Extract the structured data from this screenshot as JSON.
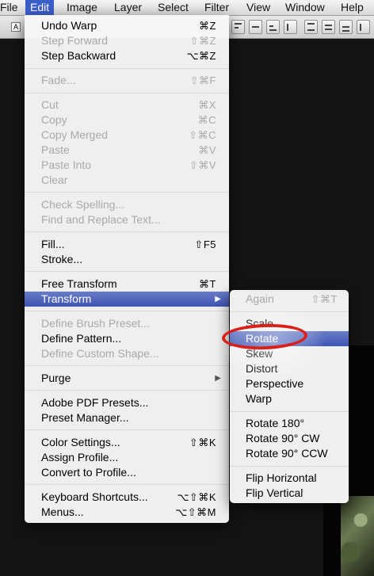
{
  "menubar": {
    "items": [
      "File",
      "Edit",
      "Image",
      "Layer",
      "Select",
      "Filter",
      "View",
      "Window",
      "Help"
    ],
    "active": "Edit"
  },
  "options_bar": {
    "checkbox_label": "A"
  },
  "edit_menu": {
    "undo_warp": {
      "label": "Undo Warp",
      "shortcut": "⌘Z"
    },
    "step_forward": {
      "label": "Step Forward",
      "shortcut": "⇧⌘Z"
    },
    "step_backward": {
      "label": "Step Backward",
      "shortcut": "⌥⌘Z"
    },
    "fade": {
      "label": "Fade...",
      "shortcut": "⇧⌘F"
    },
    "cut": {
      "label": "Cut",
      "shortcut": "⌘X"
    },
    "copy": {
      "label": "Copy",
      "shortcut": "⌘C"
    },
    "copy_merged": {
      "label": "Copy Merged",
      "shortcut": "⇧⌘C"
    },
    "paste": {
      "label": "Paste",
      "shortcut": "⌘V"
    },
    "paste_into": {
      "label": "Paste Into",
      "shortcut": "⇧⌘V"
    },
    "clear": {
      "label": "Clear"
    },
    "check_spelling": {
      "label": "Check Spelling..."
    },
    "find_replace": {
      "label": "Find and Replace Text..."
    },
    "fill": {
      "label": "Fill...",
      "shortcut": "⇧F5"
    },
    "stroke": {
      "label": "Stroke..."
    },
    "free_transform": {
      "label": "Free Transform",
      "shortcut": "⌘T"
    },
    "transform": {
      "label": "Transform",
      "arrow": "▶"
    },
    "define_brush": {
      "label": "Define Brush Preset..."
    },
    "define_pattern": {
      "label": "Define Pattern..."
    },
    "define_custom_shape": {
      "label": "Define Custom Shape..."
    },
    "purge": {
      "label": "Purge",
      "arrow": "▶"
    },
    "pdf_presets": {
      "label": "Adobe PDF Presets..."
    },
    "preset_manager": {
      "label": "Preset Manager..."
    },
    "color_settings": {
      "label": "Color Settings...",
      "shortcut": "⇧⌘K"
    },
    "assign_profile": {
      "label": "Assign Profile..."
    },
    "convert_profile": {
      "label": "Convert to Profile..."
    },
    "keyboard_shortcuts": {
      "label": "Keyboard Shortcuts...",
      "shortcut": "⌥⇧⌘K"
    },
    "menus": {
      "label": "Menus...",
      "shortcut": "⌥⇧⌘M"
    }
  },
  "transform_submenu": {
    "again": {
      "label": "Again",
      "shortcut": "⇧⌘T"
    },
    "scale": {
      "label": "Scale"
    },
    "rotate": {
      "label": "Rotate"
    },
    "skew": {
      "label": "Skew"
    },
    "distort": {
      "label": "Distort"
    },
    "perspective": {
      "label": "Perspective"
    },
    "warp": {
      "label": "Warp"
    },
    "rotate_180": {
      "label": "Rotate 180°"
    },
    "rotate_90_cw": {
      "label": "Rotate 90° CW"
    },
    "rotate_90_ccw": {
      "label": "Rotate 90° CCW"
    },
    "flip_horizontal": {
      "label": "Flip Horizontal"
    },
    "flip_vertical": {
      "label": "Flip Vertical"
    }
  },
  "colors": {
    "highlight": "#3d55b4",
    "annotation": "#d8211b",
    "disabled_text": "#a9a9a9"
  }
}
